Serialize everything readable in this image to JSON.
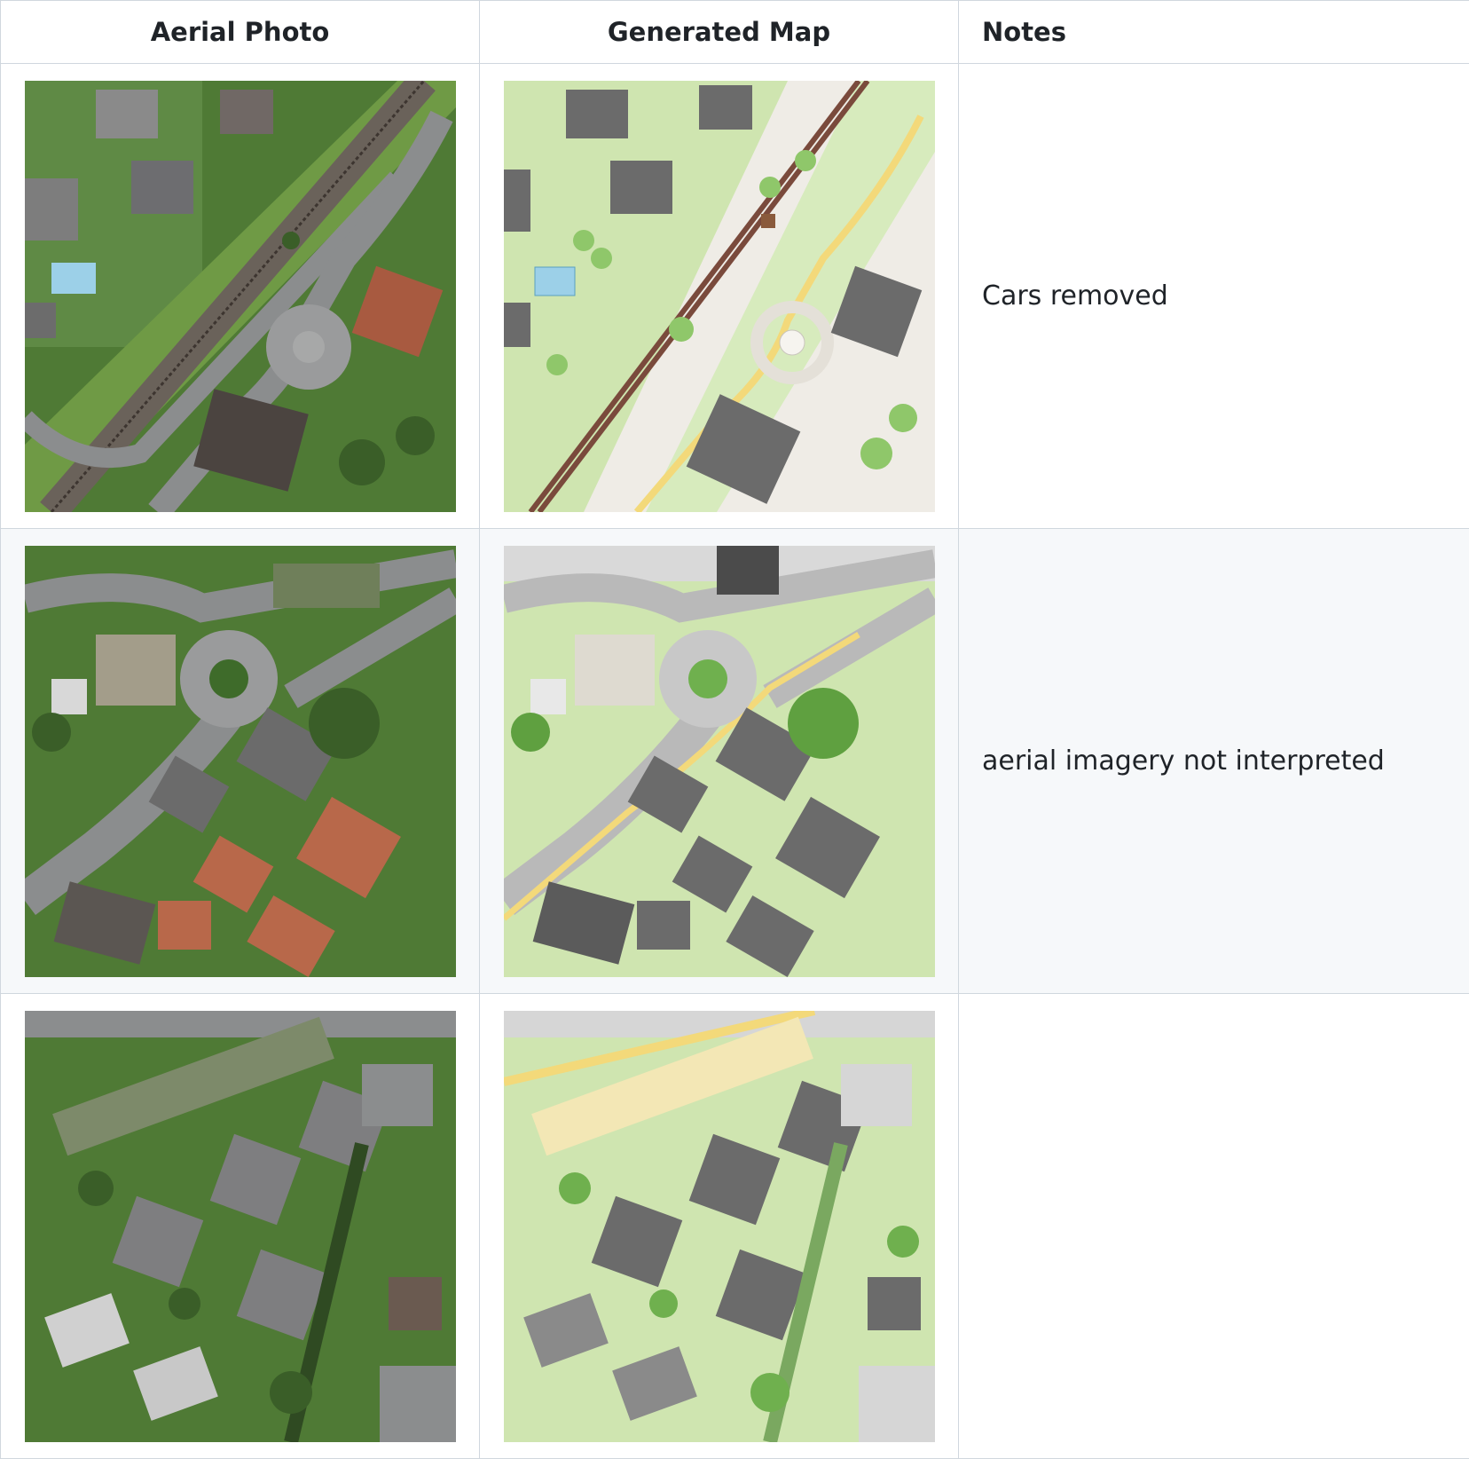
{
  "table": {
    "headers": [
      "Aerial Photo",
      "Generated Map",
      "Notes"
    ],
    "rows": [
      {
        "aerial_icon": "aerial-photo-railway-roundabout",
        "map_icon": "generated-map-railway-roundabout",
        "note": "Cars removed"
      },
      {
        "aerial_icon": "aerial-photo-roundabout-houses",
        "map_icon": "generated-map-roundabout-houses",
        "note": "aerial imagery not interpreted"
      },
      {
        "aerial_icon": "aerial-photo-apartment-blocks",
        "map_icon": "generated-map-apartment-blocks",
        "note": ""
      }
    ]
  },
  "colors": {
    "border": "#d0d7de",
    "alt_row": "#f6f8fa",
    "map_green": "#cfe5b0",
    "map_road": "#efece6",
    "aerial_green": "#4f7a35",
    "aerial_road": "#8b8d8e",
    "building_roof": "#6b6b6b",
    "tile_roof": "#b8684a",
    "rail": "#7a4a3c",
    "road_yellow": "#f3d97a"
  }
}
